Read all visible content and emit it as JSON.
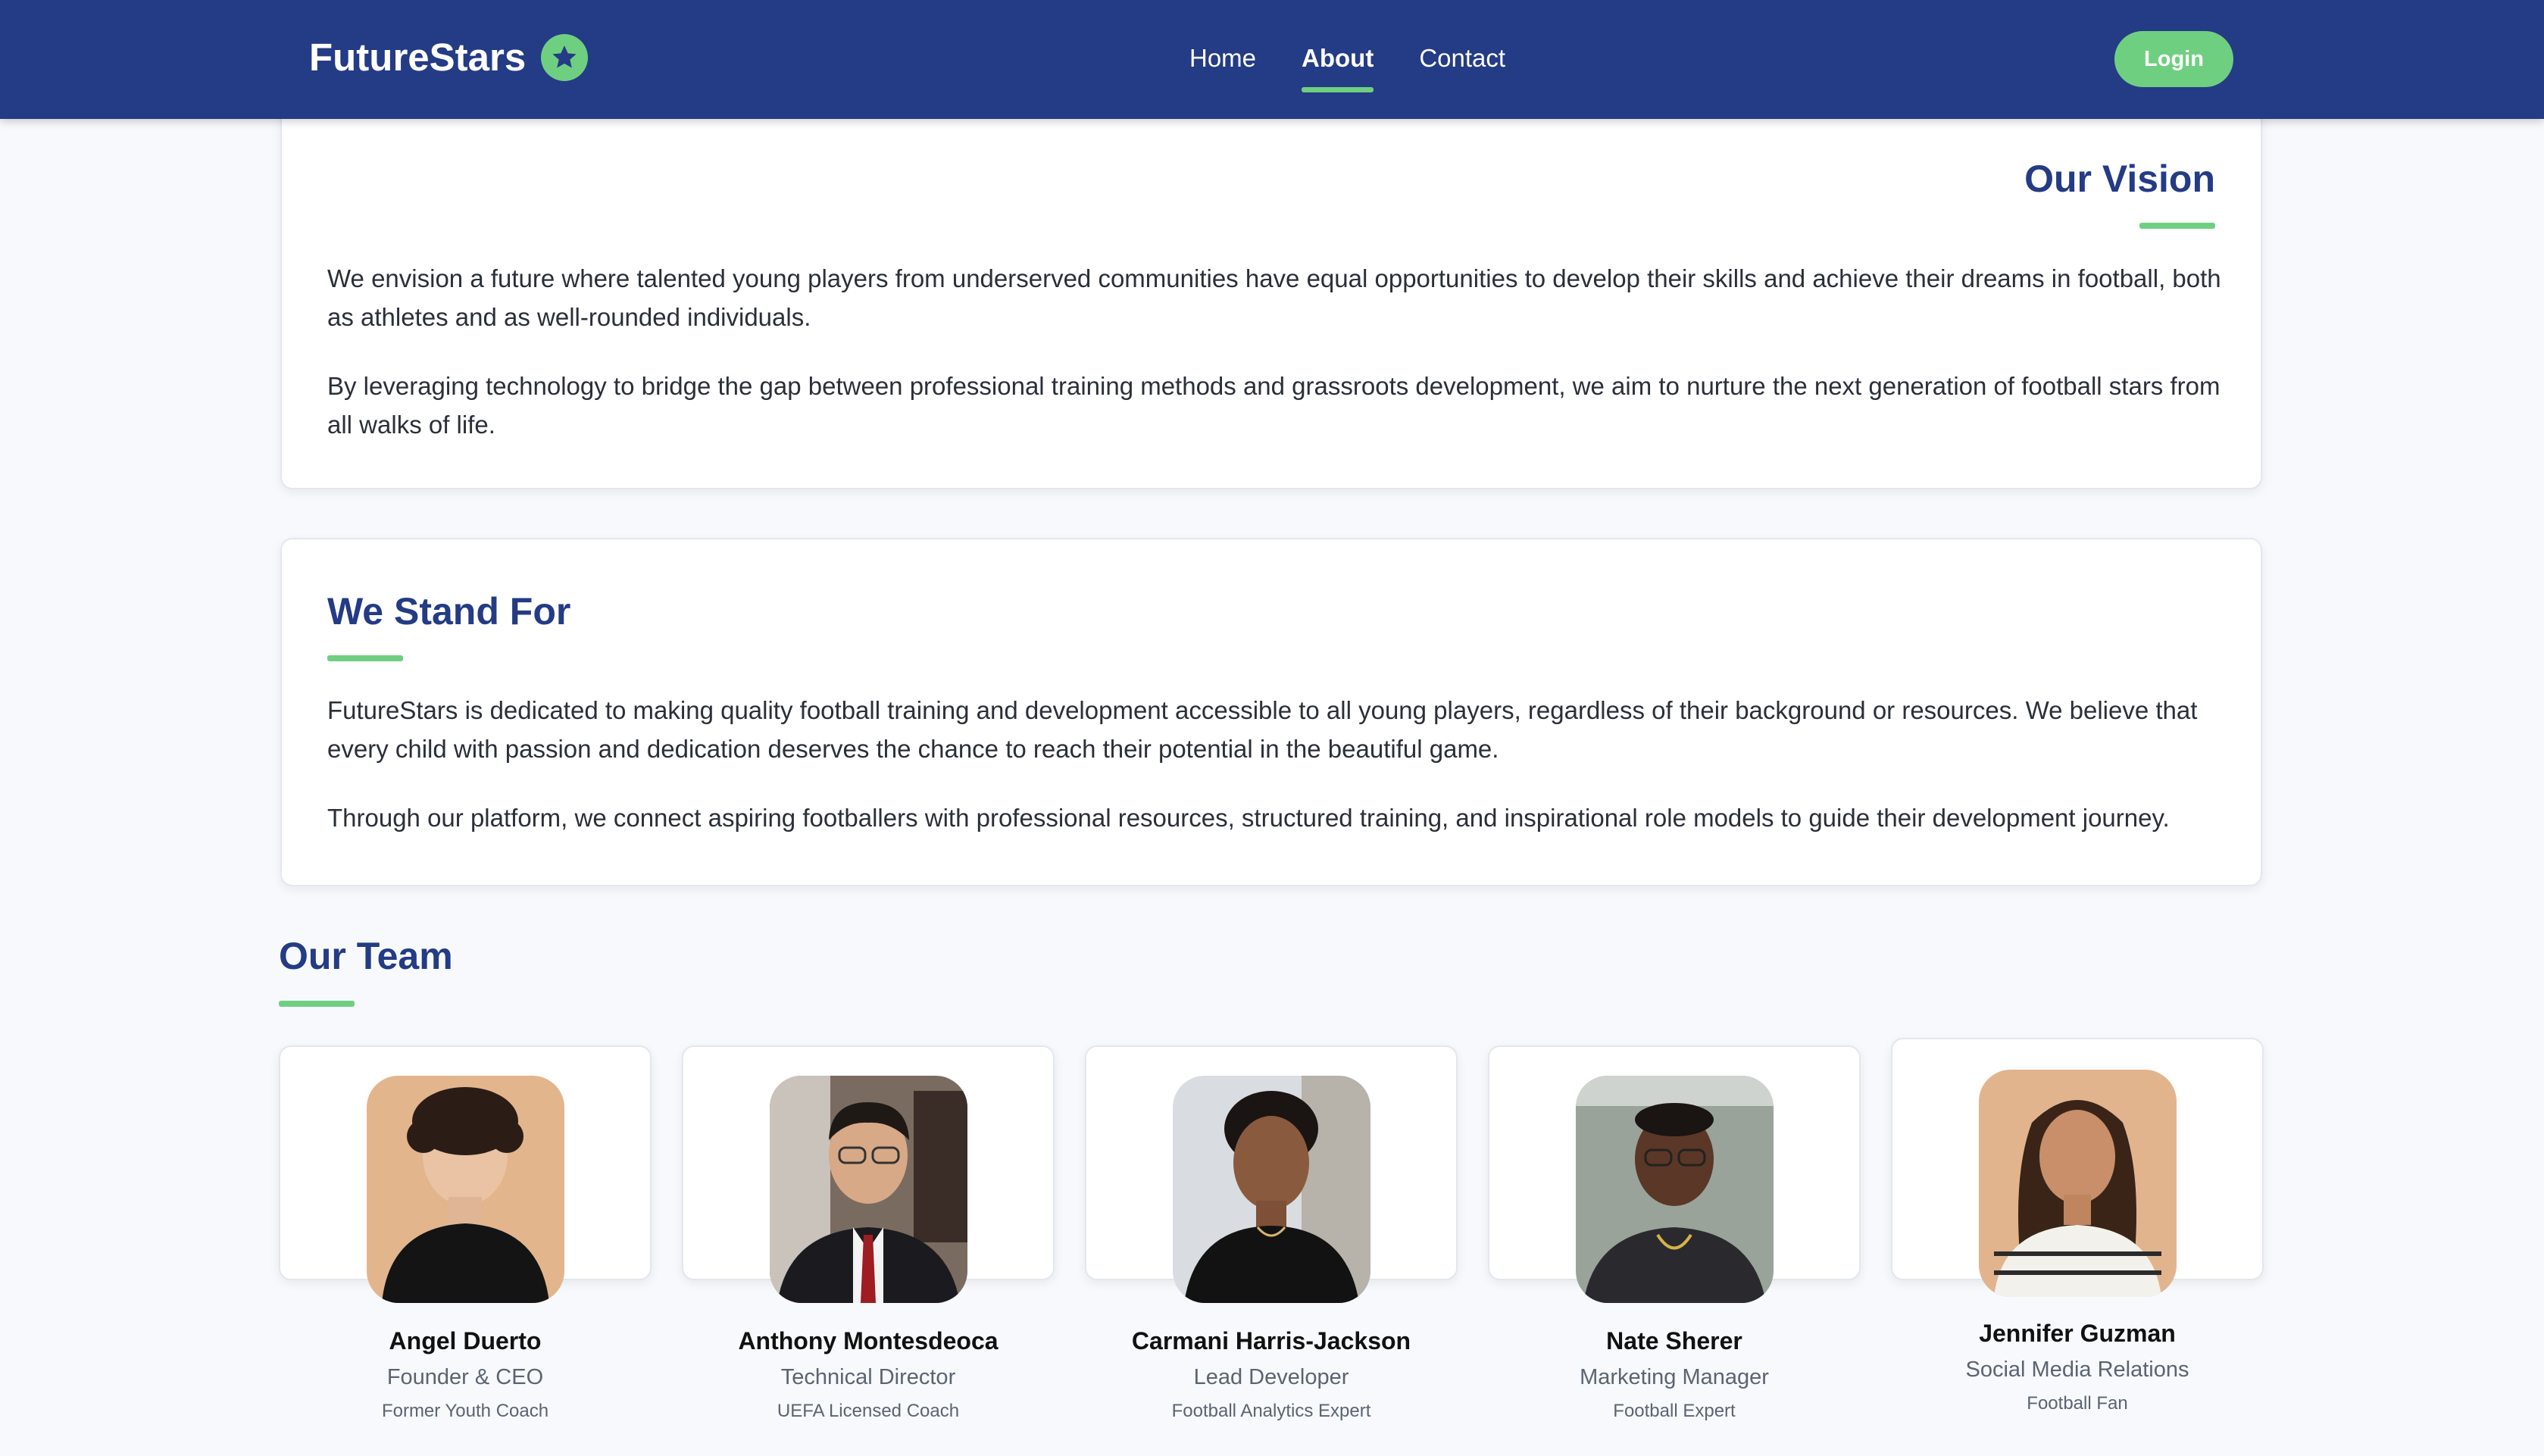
{
  "navbar": {
    "brand": "FutureStars",
    "brand_icon": "star-badge-icon",
    "links": [
      {
        "label": "Home",
        "active": false
      },
      {
        "label": "About",
        "active": true
      },
      {
        "label": "Contact",
        "active": false
      }
    ],
    "login_label": "Login"
  },
  "vision": {
    "title": "Our Vision",
    "paragraphs": [
      "We envision a future where talented young players from underserved communities have equal opportunities to develop their skills and achieve their dreams in football, both as athletes and as well-rounded individuals.",
      "By leveraging technology to bridge the gap between professional training methods and grassroots development, we aim to nurture the next generation of football stars from all walks of life."
    ]
  },
  "stand_for": {
    "title": "We Stand For",
    "paragraphs": [
      "FutureStars is dedicated to making quality football training and development accessible to all young players, regardless of their background or resources. We believe that every child with passion and dedication deserves the chance to reach their potential in the beautiful game.",
      "Through our platform, we connect aspiring footballers with professional resources, structured training, and inspirational role models to guide their development journey."
    ]
  },
  "team": {
    "title": "Our Team",
    "members": [
      {
        "name": "Angel Duerto",
        "role": "Founder & CEO",
        "extra": "Former Youth Coach"
      },
      {
        "name": "Anthony Montesdeoca",
        "role": "Technical Director",
        "extra": "UEFA Licensed Coach"
      },
      {
        "name": "Carmani Harris-Jackson",
        "role": "Lead Developer",
        "extra": "Football Analytics Expert"
      },
      {
        "name": "Nate Sherer",
        "role": "Marketing Manager",
        "extra": "Football Expert"
      },
      {
        "name": "Jennifer Guzman",
        "role": "Social Media Relations",
        "extra": "Football Fan"
      }
    ]
  },
  "colors": {
    "nav_bg": "#243b85",
    "accent": "#6fcf80",
    "heading": "#243b85",
    "page_bg": "#f7f9fc"
  }
}
